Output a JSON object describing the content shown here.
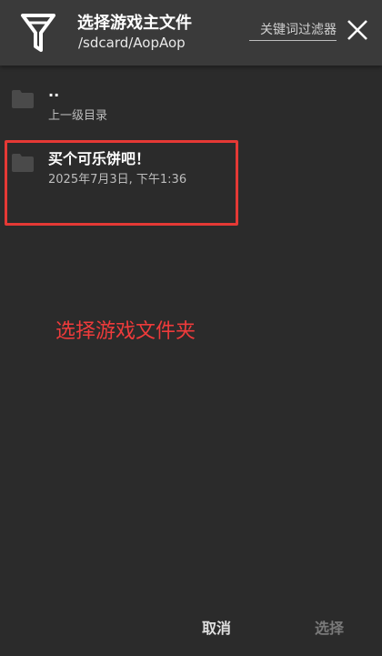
{
  "header": {
    "title": "选择游戏主文件",
    "path": "/sdcard/AopAop",
    "filter_placeholder": "关键词过滤器",
    "filter_value": ""
  },
  "list": {
    "items": [
      {
        "name": "..",
        "sub": "上一级目录",
        "icon": "folder-icon"
      },
      {
        "name": "买个可乐饼吧！",
        "sub": "2025年7月3日, 下午1:36",
        "icon": "folder-icon"
      }
    ]
  },
  "annotation": "选择游戏文件夹",
  "footer": {
    "cancel_label": "取消",
    "select_label": "选择"
  },
  "colors": {
    "background": "#2b2b2b",
    "header": "#3a3a3a",
    "highlight": "#e53935",
    "annotation": "#ee3b3b",
    "disabled": "#7a7a7a"
  }
}
